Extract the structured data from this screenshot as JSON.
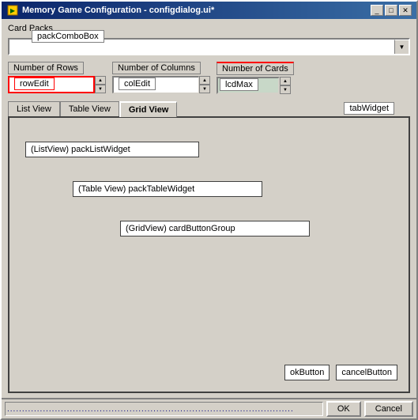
{
  "window": {
    "title": "Memory Game Configuration - configdialog.ui*",
    "icon": "🎮"
  },
  "title_buttons": {
    "minimize": "_",
    "maximize": "□",
    "close": "✕"
  },
  "card_packs": {
    "label": "Card Packs",
    "combobox_name": "packComboBox"
  },
  "spinners": {
    "rows": {
      "label": "Number of Rows",
      "input_name": "rowEdit",
      "value": ""
    },
    "cols": {
      "label": "Number of Columns",
      "input_name": "colEdit",
      "value": ""
    },
    "cards": {
      "label": "Number of Cards",
      "input_name": "lcdMax",
      "value": ""
    }
  },
  "tabs": {
    "widget_label": "tabWidget",
    "items": [
      {
        "label": "List View",
        "active": false
      },
      {
        "label": "Table View",
        "active": false
      },
      {
        "label": "Grid View",
        "active": true
      }
    ]
  },
  "widgets": {
    "list_widget": "(ListView) packListWidget",
    "table_widget": "(Table View) packTableWidget",
    "grid_widget": "(GridView) cardButtonGroup"
  },
  "buttons": {
    "ok_label": "okButton",
    "cancel_label": "cancelButton"
  },
  "status_bar": {
    "ok_label": "OK",
    "cancel_label": "Cancel",
    "dots": "................................................................................................"
  }
}
